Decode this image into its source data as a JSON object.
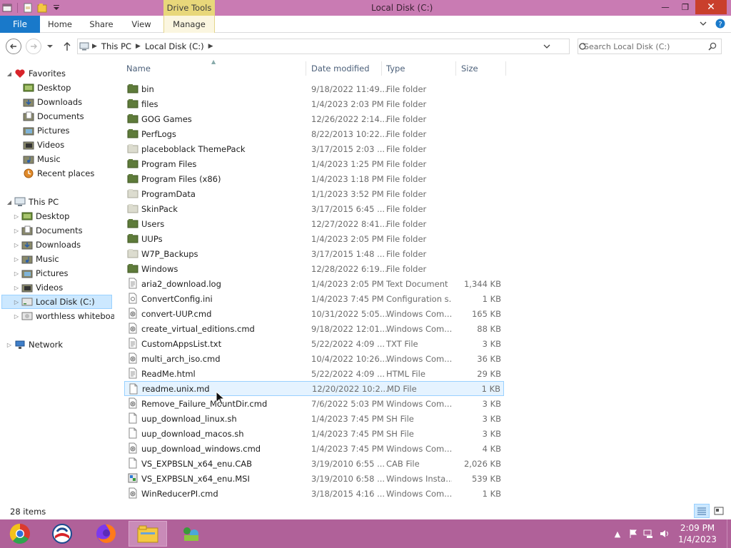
{
  "window": {
    "title": "Local Disk (C:)",
    "context_tab": "Drive Tools",
    "controls": {
      "minimize": "—",
      "maximize": "❐",
      "close": "✕"
    }
  },
  "ribbon": {
    "tabs": [
      {
        "label": "File"
      },
      {
        "label": "Home"
      },
      {
        "label": "Share"
      },
      {
        "label": "View"
      },
      {
        "label": "Manage"
      }
    ]
  },
  "address": {
    "crumbs": [
      "This PC",
      "Local Disk (C:)"
    ],
    "search_placeholder": "Search Local Disk (C:)"
  },
  "navpane": {
    "favorites": {
      "label": "Favorites",
      "items": [
        "Desktop",
        "Downloads",
        "Documents",
        "Pictures",
        "Videos",
        "Music",
        "Recent places"
      ]
    },
    "thispc": {
      "label": "This PC",
      "items": [
        "Desktop",
        "Documents",
        "Downloads",
        "Music",
        "Pictures",
        "Videos",
        "Local Disk (C:)",
        "worthless whiteboard"
      ]
    },
    "network": {
      "label": "Network"
    }
  },
  "columns": {
    "name": "Name",
    "date": "Date modified",
    "type": "Type",
    "size": "Size"
  },
  "files": [
    {
      "name": "bin",
      "date": "9/18/2022 11:49...",
      "type": "File folder",
      "size": "",
      "icon": "folder-icon"
    },
    {
      "name": "files",
      "date": "1/4/2023 2:03 PM",
      "type": "File folder",
      "size": "",
      "icon": "folder-icon"
    },
    {
      "name": "GOG Games",
      "date": "12/26/2022 2:14...",
      "type": "File folder",
      "size": "",
      "icon": "folder-icon"
    },
    {
      "name": "PerfLogs",
      "date": "8/22/2013 10:22...",
      "type": "File folder",
      "size": "",
      "icon": "folder-icon"
    },
    {
      "name": "placeboblack ThemePack",
      "date": "3/17/2015 2:03 ...",
      "type": "File folder",
      "size": "",
      "icon": "folder-light-icon"
    },
    {
      "name": "Program Files",
      "date": "1/4/2023 1:25 PM",
      "type": "File folder",
      "size": "",
      "icon": "folder-icon"
    },
    {
      "name": "Program Files (x86)",
      "date": "1/4/2023 1:18 PM",
      "type": "File folder",
      "size": "",
      "icon": "folder-icon"
    },
    {
      "name": "ProgramData",
      "date": "1/1/2023 3:52 PM",
      "type": "File folder",
      "size": "",
      "icon": "folder-light-icon"
    },
    {
      "name": "SkinPack",
      "date": "3/17/2015 6:45 ...",
      "type": "File folder",
      "size": "",
      "icon": "folder-light-icon"
    },
    {
      "name": "Users",
      "date": "12/27/2022 8:41...",
      "type": "File folder",
      "size": "",
      "icon": "folder-icon"
    },
    {
      "name": "UUPs",
      "date": "1/4/2023 2:05 PM",
      "type": "File folder",
      "size": "",
      "icon": "folder-icon"
    },
    {
      "name": "W7P_Backups",
      "date": "3/17/2015 1:48 ...",
      "type": "File folder",
      "size": "",
      "icon": "folder-light-icon"
    },
    {
      "name": "Windows",
      "date": "12/28/2022 6:19...",
      "type": "File folder",
      "size": "",
      "icon": "folder-icon"
    },
    {
      "name": "aria2_download.log",
      "date": "1/4/2023 2:05 PM",
      "type": "Text Document",
      "size": "1,344 KB",
      "icon": "text-file-icon"
    },
    {
      "name": "ConvertConfig.ini",
      "date": "1/4/2023 7:45 PM",
      "type": "Configuration s...",
      "size": "1 KB",
      "icon": "config-file-icon"
    },
    {
      "name": "convert-UUP.cmd",
      "date": "10/31/2022 5:05...",
      "type": "Windows Com...",
      "size": "165 KB",
      "icon": "cmd-file-icon"
    },
    {
      "name": "create_virtual_editions.cmd",
      "date": "9/18/2022 12:01...",
      "type": "Windows Com...",
      "size": "88 KB",
      "icon": "cmd-file-icon"
    },
    {
      "name": "CustomAppsList.txt",
      "date": "5/22/2022 4:09 ...",
      "type": "TXT File",
      "size": "3 KB",
      "icon": "text-file-icon"
    },
    {
      "name": "multi_arch_iso.cmd",
      "date": "10/4/2022 10:26...",
      "type": "Windows Com...",
      "size": "36 KB",
      "icon": "cmd-file-icon"
    },
    {
      "name": "ReadMe.html",
      "date": "5/22/2022 4:09 ...",
      "type": "HTML File",
      "size": "29 KB",
      "icon": "text-file-icon"
    },
    {
      "name": "readme.unix.md",
      "date": "12/20/2022 10:2...",
      "type": "MD File",
      "size": "1 KB",
      "icon": "blank-file-icon"
    },
    {
      "name": "Remove_Failure_MountDir.cmd",
      "date": "7/6/2022 5:03 PM",
      "type": "Windows Com...",
      "size": "3 KB",
      "icon": "cmd-file-icon"
    },
    {
      "name": "uup_download_linux.sh",
      "date": "1/4/2023 7:45 PM",
      "type": "SH File",
      "size": "3 KB",
      "icon": "blank-file-icon"
    },
    {
      "name": "uup_download_macos.sh",
      "date": "1/4/2023 7:45 PM",
      "type": "SH File",
      "size": "3 KB",
      "icon": "blank-file-icon"
    },
    {
      "name": "uup_download_windows.cmd",
      "date": "1/4/2023 7:45 PM",
      "type": "Windows Com...",
      "size": "4 KB",
      "icon": "cmd-file-icon"
    },
    {
      "name": "VS_EXPBSLN_x64_enu.CAB",
      "date": "3/19/2010 6:55 ...",
      "type": "CAB File",
      "size": "2,026 KB",
      "icon": "blank-file-icon"
    },
    {
      "name": "VS_EXPBSLN_x64_enu.MSI",
      "date": "3/19/2010 6:58 ...",
      "type": "Windows Insta...",
      "size": "539 KB",
      "icon": "msi-file-icon"
    },
    {
      "name": "WinReducerPI.cmd",
      "date": "3/18/2015 4:16 ...",
      "type": "Windows Com...",
      "size": "1 KB",
      "icon": "cmd-file-icon"
    }
  ],
  "status": {
    "count": "28 items"
  },
  "taskbar": {
    "apps": [
      "chrome-icon",
      "obama-logo-icon",
      "firefox-icon",
      "file-explorer-icon",
      "network-app-icon"
    ],
    "clock_time": "2:09 PM",
    "clock_date": "1/4/2023"
  },
  "colors": {
    "titlebar": "#c97bb3",
    "taskbar": "#b06199",
    "file_tab": "#1979ca",
    "drive_tools": "#e8d77a",
    "selection": "#cce8ff"
  }
}
